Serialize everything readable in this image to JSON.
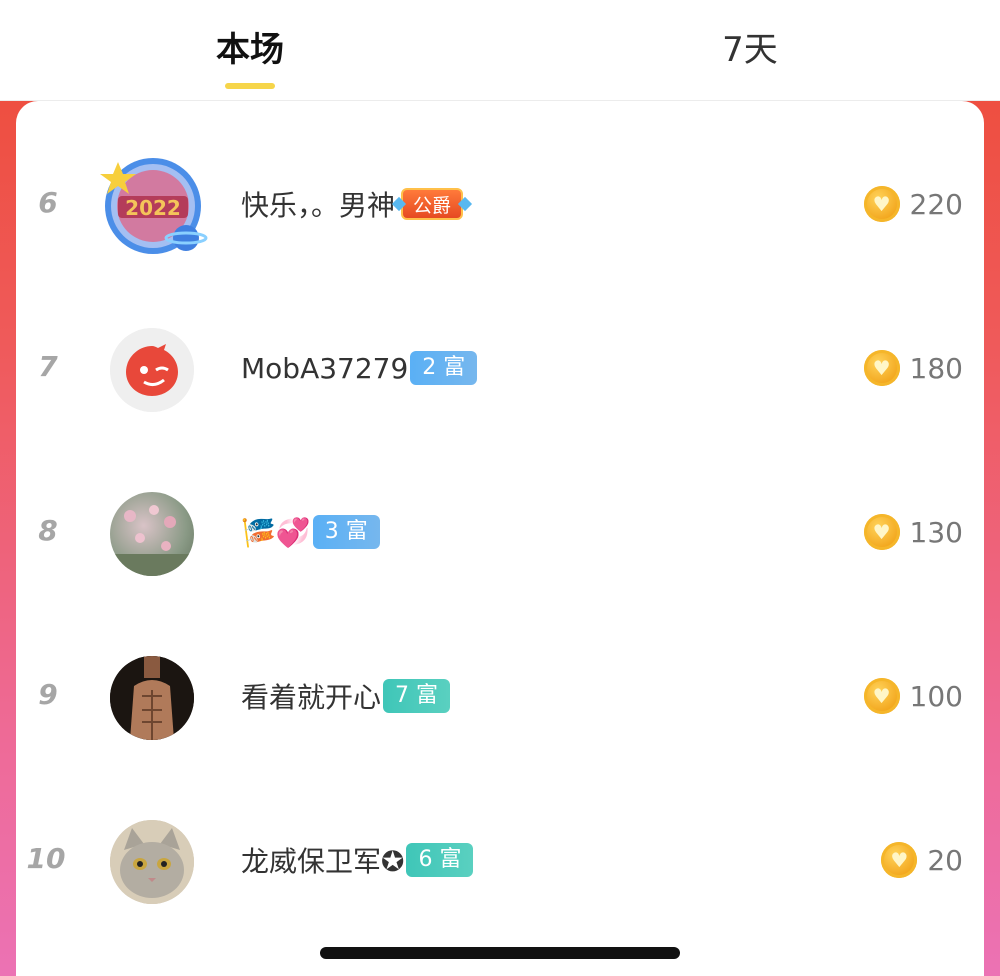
{
  "tabs": [
    {
      "label": "本场",
      "active": true
    },
    {
      "label": "7天",
      "active": false
    }
  ],
  "rows": [
    {
      "rank": "6",
      "name": "快乐，。男神",
      "badge": {
        "type": "noble",
        "text": "公爵"
      },
      "score": "220",
      "avatar": "2022-frame-avatar"
    },
    {
      "rank": "7",
      "name": "MobA37279",
      "badge": {
        "type": "blue",
        "text": "2 富"
      },
      "score": "180",
      "avatar": "red-wink-avatar"
    },
    {
      "rank": "8",
      "name": "🎏💞",
      "badge": {
        "type": "blue",
        "text": "3 富"
      },
      "score": "130",
      "avatar": "blossom-photo-avatar"
    },
    {
      "rank": "9",
      "name": "看着就开心",
      "badge": {
        "type": "teal",
        "text": "7 富"
      },
      "score": "100",
      "avatar": "torso-photo-avatar"
    },
    {
      "rank": "10",
      "name": "龙威保卫军✪",
      "badge": {
        "type": "teal",
        "text": "6 富"
      },
      "score": "20",
      "avatar": "cat-photo-avatar"
    }
  ],
  "icons": {
    "coin": "gold-heart-coin-icon"
  },
  "colors": {
    "accent_underline": "#f6d54a",
    "badge_blue": "#5ab0f5",
    "badge_teal": "#3fc6b8",
    "noble_orange": "#e64a22"
  }
}
